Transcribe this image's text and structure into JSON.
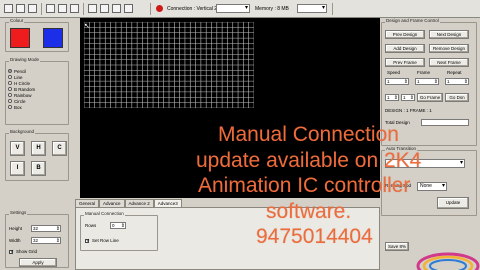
{
  "toolbar": {
    "connection": "Connection : Vertical 2",
    "memory": "Memory : 8 MB"
  },
  "left": {
    "colour_group_title": "Colour",
    "colors": {
      "primary": "#ee1c1c",
      "secondary": "#1c2ee8"
    },
    "drawing_mode_title": "Drawing Mode",
    "drawing_modes": [
      "Pencil",
      "Line",
      "H Circle",
      "B Random",
      "Rainbow",
      "Circle",
      "Box"
    ],
    "background_title": "Background",
    "bg_buttons": [
      "V",
      "H",
      "C",
      "I",
      "B"
    ],
    "settings_title": "Settings",
    "height_label": "Height",
    "height_value": "32",
    "width_label": "Width",
    "width_value": "32",
    "show_grid_label": "Show Grid",
    "apply_label": "Apply"
  },
  "tabs": [
    "General",
    "Advance",
    "Advance 2",
    "Advance3"
  ],
  "bottom_panel": {
    "group_title": "Manual Connection",
    "field_label": "Rows",
    "field_value": "0",
    "checkbox_label": "Set Row Line"
  },
  "right": {
    "group_title": "Design and Frame Control",
    "buttons_row1": [
      "Prev Design",
      "Next Design"
    ],
    "buttons_row2": [
      "Add Design",
      "Remove Design"
    ],
    "buttons_row3": [
      "Prev Frame",
      "Next Frame"
    ],
    "speed_label": "Speed",
    "frame_label": "Frame",
    "repeat_label": "Repeat",
    "speed_value": "1",
    "frame_value": "1",
    "repeat_value": "1",
    "row5_values": [
      "1",
      "1"
    ],
    "go_frame_label": "Go Frame",
    "go_dsn_label": "Go Dsn",
    "design_line": "DESIGN : 1 FRAME : 1",
    "total_design_label": "Total Design",
    "auto_transition_title": "Auto Transition",
    "none_value": "None",
    "running_speed_label": "Running Spd",
    "update_label": "Update",
    "save_label": "Save 8%"
  },
  "overlay": {
    "line1": "Manual Connection",
    "line2": "update available on 2K4",
    "line3": "Animation IC controller",
    "line4": "software.",
    "line5": "9475014404"
  }
}
